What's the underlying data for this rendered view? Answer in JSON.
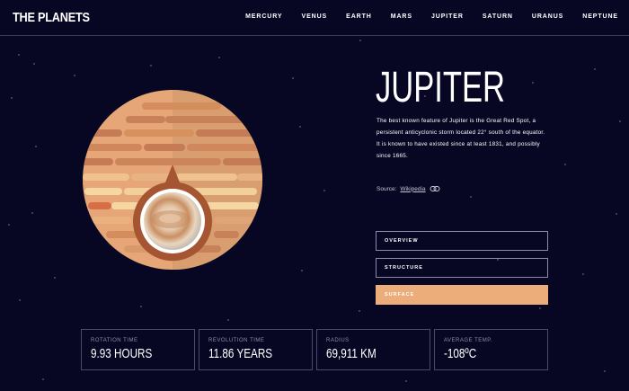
{
  "app": {
    "logo": "THE PLANETS"
  },
  "nav": {
    "items": [
      "MERCURY",
      "VENUS",
      "EARTH",
      "MARS",
      "JUPITER",
      "SATURN",
      "URANUS",
      "NEPTUNE"
    ]
  },
  "planet": {
    "name": "JUPITER",
    "description": "The best known feature of Jupiter is the Great Red Spot, a persistent anticyclonic storm located 22° south of the equator. It is known to have existed since at least 1831, and possibly since 1665.",
    "source_prefix": "Source:",
    "source_link": "Wikipedia",
    "accent_color": "#ECAD7A"
  },
  "tabs": [
    {
      "label": "OVERVIEW",
      "active": false
    },
    {
      "label": "STRUCTURE",
      "active": false
    },
    {
      "label": "SURFACE",
      "active": true
    }
  ],
  "stats": [
    {
      "label": "ROTATION TIME",
      "value": "9.93 HOURS"
    },
    {
      "label": "REVOLUTION TIME",
      "value": "11.86 YEARS"
    },
    {
      "label": "RADIUS",
      "value": "69,911 KM"
    },
    {
      "label": "AVERAGE TEMP.",
      "value": "-108ºC"
    }
  ]
}
